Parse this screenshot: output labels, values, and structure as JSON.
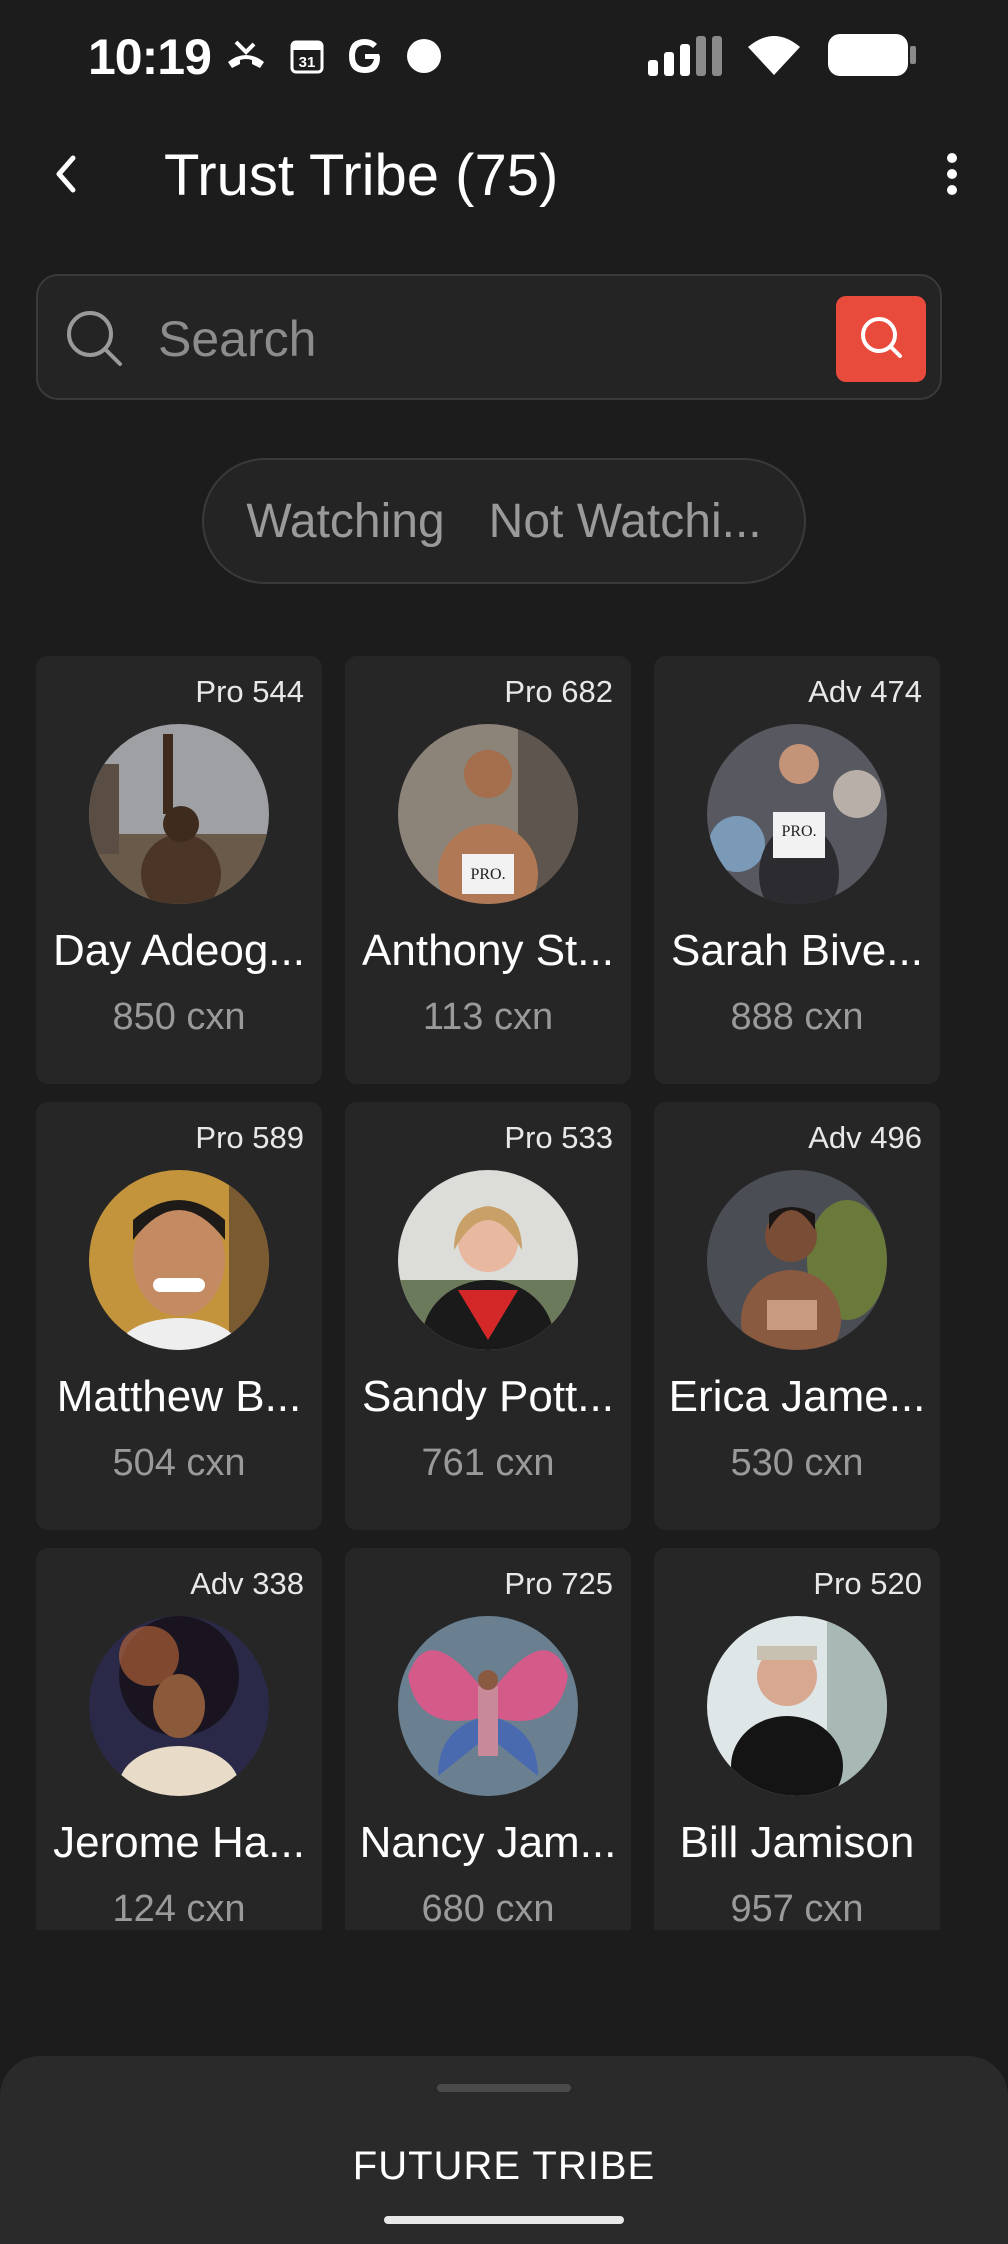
{
  "status_bar": {
    "time": "10:19",
    "calendar_day": "31",
    "left_icons": [
      "missed-call-icon",
      "calendar-icon",
      "google-icon",
      "dot-icon"
    ],
    "right_icons": [
      "signal-icon",
      "wifi-icon",
      "battery-icon"
    ]
  },
  "header": {
    "title": "Trust Tribe (75)",
    "back_icon": "chevron-left-icon",
    "more_icon": "more-vertical-icon"
  },
  "search": {
    "placeholder": "Search",
    "value": "",
    "accent_color": "#e84a3c"
  },
  "filter_toggle": {
    "options": [
      "Watching",
      "Not Watchi..."
    ]
  },
  "members": [
    {
      "level": "Pro 544",
      "name": "Day Adeog...",
      "cxn": "850 cxn"
    },
    {
      "level": "Pro 682",
      "name": "Anthony St...",
      "cxn": "113 cxn"
    },
    {
      "level": "Adv 474",
      "name": "Sarah Bive...",
      "cxn": "888 cxn"
    },
    {
      "level": "Pro 589",
      "name": "Matthew B...",
      "cxn": "504 cxn"
    },
    {
      "level": "Pro 533",
      "name": "Sandy Pott...",
      "cxn": "761 cxn"
    },
    {
      "level": "Adv 496",
      "name": "Erica Jame...",
      "cxn": "530 cxn"
    },
    {
      "level": "Adv 338",
      "name": "Jerome Ha...",
      "cxn": "124 cxn"
    },
    {
      "level": "Pro 725",
      "name": "Nancy Jam...",
      "cxn": "680 cxn"
    },
    {
      "level": "Pro 520",
      "name": "Bill Jamison",
      "cxn": "957 cxn"
    }
  ],
  "bottom_sheet": {
    "title": "FUTURE TRIBE"
  }
}
